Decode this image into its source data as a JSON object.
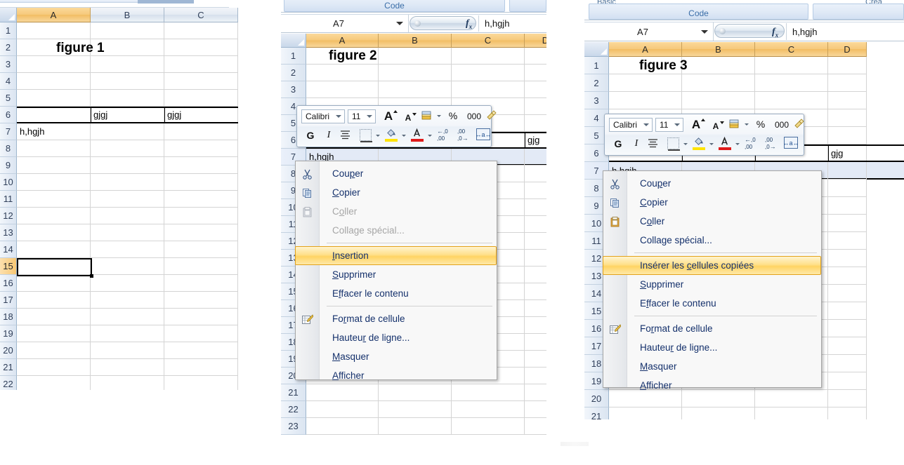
{
  "figures": [
    {
      "id": "figure-1",
      "title": "figure 1",
      "columns": [
        "A",
        "B",
        "C"
      ],
      "rows": [
        "1",
        "2",
        "3",
        "4",
        "5",
        "6",
        "7",
        "8",
        "9",
        "10",
        "11",
        "12",
        "13",
        "14",
        "15",
        "16",
        "17",
        "18",
        "19",
        "20",
        "21",
        "22"
      ],
      "selected_row": "15",
      "cells": [
        {
          "row": "6",
          "col": "B",
          "value": "gjgj"
        },
        {
          "row": "6",
          "col": "C",
          "value": "gjgj"
        },
        {
          "row": "7",
          "col": "A",
          "value": "h,hgjh"
        }
      ]
    },
    {
      "id": "figure-2",
      "title": "figure 2",
      "ribbon_group_label": "Code",
      "name_box": "A7",
      "formula_value": "h,hgjh",
      "columns": [
        "A",
        "B",
        "C",
        "D"
      ],
      "rows": [
        "1",
        "2",
        "3",
        "4",
        "5",
        "6",
        "7",
        "8",
        "9",
        "10",
        "11",
        "12",
        "13",
        "14",
        "15",
        "16",
        "17",
        "18",
        "19",
        "20",
        "21",
        "22",
        "23"
      ],
      "selected_row": "7",
      "cells": [
        {
          "row": "6",
          "col": "D",
          "value": "gjg"
        },
        {
          "row": "7",
          "col": "A",
          "value": "h,hgjh"
        }
      ]
    },
    {
      "id": "figure-3",
      "title": "figure 3",
      "ribbon_group_label": "Code",
      "ribbon_left_caption": "Basic",
      "ribbon_right_caption": "Crea",
      "name_box": "A7",
      "formula_value": "h,hgjh",
      "columns": [
        "A",
        "B",
        "C",
        "D"
      ],
      "rows": [
        "1",
        "2",
        "3",
        "4",
        "5",
        "6",
        "7",
        "8",
        "9",
        "10",
        "11",
        "12",
        "13",
        "14",
        "15",
        "16",
        "17",
        "18",
        "19",
        "20",
        "21"
      ],
      "selected_row": "7",
      "cells": [
        {
          "row": "6",
          "col": "D",
          "value": "gjg"
        },
        {
          "row": "7",
          "col": "A",
          "value": "h,hgjh"
        }
      ]
    }
  ],
  "mini_toolbar": {
    "font_name": "Calibri",
    "font_size": "11",
    "percent_label": "%",
    "thousands_label": "000",
    "bold_label": "G",
    "italic_label": "I",
    "buttons": [
      {
        "name": "grow-font-icon",
        "label": "A"
      },
      {
        "name": "shrink-font-icon",
        "label": "A"
      },
      {
        "name": "accounting-format-icon",
        "label": ""
      },
      {
        "name": "percent-style-icon",
        "label": "%"
      },
      {
        "name": "comma-style-icon",
        "label": "000"
      },
      {
        "name": "format-painter-icon",
        "label": ""
      },
      {
        "name": "bold-icon",
        "label": "G"
      },
      {
        "name": "italic-icon",
        "label": "I"
      },
      {
        "name": "center-align-icon",
        "label": ""
      },
      {
        "name": "borders-icon",
        "label": ""
      },
      {
        "name": "fill-color-icon",
        "label": ""
      },
      {
        "name": "font-color-icon",
        "label": "A"
      },
      {
        "name": "increase-decimal-icon",
        "label": ""
      },
      {
        "name": "decrease-decimal-icon",
        "label": ""
      },
      {
        "name": "merge-cells-icon",
        "label": ""
      }
    ]
  },
  "context_menu_figure2": {
    "items": [
      {
        "label": "Couper",
        "accel": "p",
        "state": "normal",
        "icon": "cut-icon"
      },
      {
        "label": "Copier",
        "accel": "C",
        "state": "normal",
        "icon": "copy-icon"
      },
      {
        "label": "Coller",
        "accel": "o",
        "state": "disabled",
        "icon": "paste-icon"
      },
      {
        "label": "Collage spécial...",
        "accel": "g",
        "state": "disabled",
        "icon": ""
      },
      {
        "separator": true
      },
      {
        "label": "Insertion",
        "accel": "I",
        "state": "highlighted",
        "icon": ""
      },
      {
        "label": "Supprimer",
        "accel": "S",
        "state": "normal",
        "icon": ""
      },
      {
        "label": "Effacer le contenu",
        "accel": "f",
        "state": "normal",
        "icon": ""
      },
      {
        "separator": true
      },
      {
        "label": "Format de cellule",
        "accel": "r",
        "state": "normal",
        "icon": "format-cells-icon"
      },
      {
        "label": "Hauteur de ligne...",
        "accel": "r",
        "state": "normal",
        "icon": ""
      },
      {
        "label": "Masquer",
        "accel": "M",
        "state": "normal",
        "icon": ""
      },
      {
        "label": "Afficher",
        "accel": "A",
        "state": "normal",
        "icon": ""
      }
    ]
  },
  "context_menu_figure3": {
    "items": [
      {
        "label": "Couper",
        "accel": "p",
        "state": "normal",
        "icon": "cut-icon"
      },
      {
        "label": "Copier",
        "accel": "C",
        "state": "normal",
        "icon": "copy-icon"
      },
      {
        "label": "Coller",
        "accel": "o",
        "state": "normal",
        "icon": "paste-icon"
      },
      {
        "label": "Collage spécial...",
        "accel": "g",
        "state": "normal",
        "icon": ""
      },
      {
        "separator": true
      },
      {
        "label": "Insérer les cellules copiées",
        "accel": "c",
        "state": "highlighted",
        "icon": ""
      },
      {
        "label": "Supprimer",
        "accel": "S",
        "state": "normal",
        "icon": ""
      },
      {
        "label": "Effacer le contenu",
        "accel": "f",
        "state": "normal",
        "icon": ""
      },
      {
        "separator": true
      },
      {
        "label": "Format de cellule",
        "accel": "r",
        "state": "normal",
        "icon": "format-cells-icon"
      },
      {
        "label": "Hauteur de ligne...",
        "accel": "r",
        "state": "normal",
        "icon": ""
      },
      {
        "label": "Masquer",
        "accel": "M",
        "state": "normal",
        "icon": ""
      },
      {
        "label": "Afficher",
        "accel": "A",
        "state": "normal",
        "icon": ""
      }
    ]
  },
  "colors": {
    "header_orange": "#f6c97b",
    "highlight_yellow": "#ffd464",
    "menu_text_blue": "#14306b",
    "grid_line": "#d4d4d4",
    "ribbon_blue": "#dfe9f6"
  }
}
